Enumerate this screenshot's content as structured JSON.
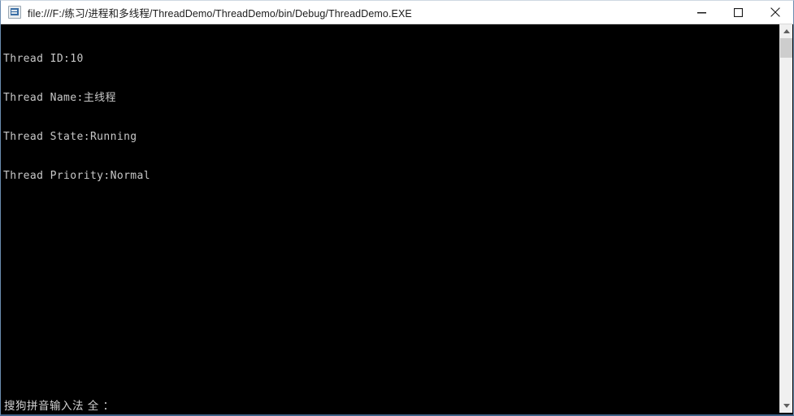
{
  "window": {
    "title": "file:///F:/练习/进程和多线程/ThreadDemo/ThreadDemo/bin/Debug/ThreadDemo.EXE",
    "icon": "console-app-icon",
    "controls": {
      "minimize": "–",
      "maximize": "□",
      "close": "✕"
    },
    "colors": {
      "titlebar_bg": "#ffffff",
      "title_text": "#1b1b1b",
      "console_bg": "#000000",
      "console_text": "#c8c8c8",
      "window_border": "#6b8cb0",
      "scrollbar_track": "#f0f0f0",
      "scrollbar_thumb": "#cdcdcd"
    }
  },
  "console": {
    "lines": [
      "Thread ID:10",
      "Thread Name:主线程",
      "Thread State:Running",
      "Thread Priority:Normal"
    ]
  },
  "ime": {
    "status": "搜狗拼音输入法 全 ："
  },
  "scrollbar": {
    "up_arrow": "scroll-up-arrow",
    "down_arrow": "scroll-down-arrow",
    "thumb": "scroll-thumb"
  }
}
